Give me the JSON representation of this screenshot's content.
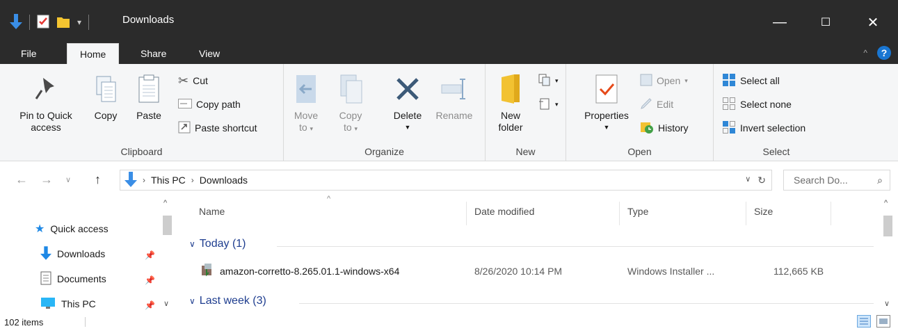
{
  "window": {
    "title": "Downloads",
    "controls": {
      "minimize": "—",
      "maximize": "☐",
      "close": "✕"
    }
  },
  "tabs": [
    {
      "label": "File"
    },
    {
      "label": "Home"
    },
    {
      "label": "Share"
    },
    {
      "label": "View"
    }
  ],
  "ribbon": {
    "clipboard": {
      "label": "Clipboard",
      "pin": "Pin to Quick\naccess",
      "pin_line1": "Pin to Quick",
      "pin_line2": "access",
      "copy": "Copy",
      "paste": "Paste",
      "cut": "Cut",
      "copy_path": "Copy path",
      "paste_shortcut": "Paste shortcut"
    },
    "organize": {
      "label": "Organize",
      "move_line1": "Move",
      "move_line2": "to",
      "copy_line1": "Copy",
      "copy_line2": "to",
      "delete": "Delete",
      "rename": "Rename"
    },
    "new": {
      "label": "New",
      "new_line1": "New",
      "new_line2": "folder"
    },
    "open": {
      "label": "Open",
      "properties": "Properties",
      "open": "Open",
      "edit": "Edit",
      "history": "History"
    },
    "select": {
      "label": "Select",
      "select_all": "Select all",
      "select_none": "Select none",
      "invert": "Invert selection"
    }
  },
  "address": {
    "segments": [
      "This PC",
      "Downloads"
    ],
    "search_placeholder": "Search Do..."
  },
  "nav": {
    "items": [
      {
        "label": "Quick access"
      },
      {
        "label": "Downloads"
      },
      {
        "label": "Documents"
      },
      {
        "label": "This PC"
      }
    ]
  },
  "columns": [
    "Name",
    "Date modified",
    "Type",
    "Size"
  ],
  "groups": [
    {
      "label": "Today (1)"
    },
    {
      "label": "Last week (3)"
    }
  ],
  "files": [
    {
      "name": "amazon-corretto-8.265.01.1-windows-x64",
      "date": "8/26/2020 10:14 PM",
      "type": "Windows Installer ...",
      "size": "112,665 KB"
    }
  ],
  "status": {
    "items": "102 items"
  },
  "colors": {
    "accent": "#1976d2",
    "group": "#1e3d8f",
    "titlebar": "#2b2b2b"
  }
}
